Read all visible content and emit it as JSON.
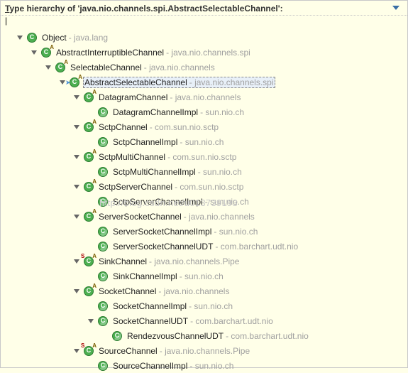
{
  "header": {
    "title_prefix": "T",
    "title_rest": "ype hierarchy of 'java.nio.channels.spi.AbstractSelectableChannel':",
    "cursor": "|"
  },
  "watermark": "http://blog.csdn.net/u013739193",
  "nodes": [
    {
      "depth": 0,
      "expand": "open",
      "icon": "class",
      "abstract": false,
      "static": false,
      "selected": false,
      "name": "Object",
      "pkg": "java.lang"
    },
    {
      "depth": 1,
      "expand": "open",
      "icon": "class",
      "abstract": true,
      "static": false,
      "selected": false,
      "name": "AbstractInterruptibleChannel",
      "pkg": "java.nio.channels.spi"
    },
    {
      "depth": 2,
      "expand": "open",
      "icon": "class",
      "abstract": true,
      "static": false,
      "selected": false,
      "name": "SelectableChannel",
      "pkg": "java.nio.channels"
    },
    {
      "depth": 3,
      "expand": "open",
      "icon": "focus",
      "abstract": true,
      "static": false,
      "selected": true,
      "name": "AbstractSelectableChannel",
      "pkg": "java.nio.channels.spi"
    },
    {
      "depth": 4,
      "expand": "open",
      "icon": "class",
      "abstract": true,
      "static": false,
      "selected": false,
      "name": "DatagramChannel",
      "pkg": "java.nio.channels"
    },
    {
      "depth": 5,
      "expand": "none",
      "icon": "impl",
      "abstract": false,
      "static": false,
      "selected": false,
      "name": "DatagramChannelImpl",
      "pkg": "sun.nio.ch"
    },
    {
      "depth": 4,
      "expand": "open",
      "icon": "class",
      "abstract": true,
      "static": false,
      "selected": false,
      "name": "SctpChannel",
      "pkg": "com.sun.nio.sctp"
    },
    {
      "depth": 5,
      "expand": "none",
      "icon": "impl",
      "abstract": false,
      "static": false,
      "selected": false,
      "name": "SctpChannelImpl",
      "pkg": "sun.nio.ch"
    },
    {
      "depth": 4,
      "expand": "open",
      "icon": "class",
      "abstract": true,
      "static": false,
      "selected": false,
      "name": "SctpMultiChannel",
      "pkg": "com.sun.nio.sctp"
    },
    {
      "depth": 5,
      "expand": "none",
      "icon": "impl",
      "abstract": false,
      "static": false,
      "selected": false,
      "name": "SctpMultiChannelImpl",
      "pkg": "sun.nio.ch"
    },
    {
      "depth": 4,
      "expand": "open",
      "icon": "class",
      "abstract": true,
      "static": false,
      "selected": false,
      "name": "SctpServerChannel",
      "pkg": "com.sun.nio.sctp"
    },
    {
      "depth": 5,
      "expand": "none",
      "icon": "impl",
      "abstract": false,
      "static": false,
      "selected": false,
      "name": "SctpServerChannelImpl",
      "pkg": "sun.nio.ch"
    },
    {
      "depth": 4,
      "expand": "open",
      "icon": "class",
      "abstract": true,
      "static": false,
      "selected": false,
      "name": "ServerSocketChannel",
      "pkg": "java.nio.channels"
    },
    {
      "depth": 5,
      "expand": "none",
      "icon": "impl",
      "abstract": false,
      "static": false,
      "selected": false,
      "name": "ServerSocketChannelImpl",
      "pkg": "sun.nio.ch"
    },
    {
      "depth": 5,
      "expand": "none",
      "icon": "impl",
      "abstract": false,
      "static": false,
      "selected": false,
      "name": "ServerSocketChannelUDT",
      "pkg": "com.barchart.udt.nio"
    },
    {
      "depth": 4,
      "expand": "open",
      "icon": "class",
      "abstract": true,
      "static": true,
      "selected": false,
      "name": "SinkChannel",
      "pkg": "java.nio.channels.Pipe"
    },
    {
      "depth": 5,
      "expand": "none",
      "icon": "impl",
      "abstract": false,
      "static": false,
      "selected": false,
      "name": "SinkChannelImpl",
      "pkg": "sun.nio.ch"
    },
    {
      "depth": 4,
      "expand": "open",
      "icon": "class",
      "abstract": true,
      "static": false,
      "selected": false,
      "name": "SocketChannel",
      "pkg": "java.nio.channels"
    },
    {
      "depth": 5,
      "expand": "none",
      "icon": "impl",
      "abstract": false,
      "static": false,
      "selected": false,
      "name": "SocketChannelImpl",
      "pkg": "sun.nio.ch"
    },
    {
      "depth": 5,
      "expand": "open",
      "icon": "impl",
      "abstract": false,
      "static": false,
      "selected": false,
      "name": "SocketChannelUDT",
      "pkg": "com.barchart.udt.nio"
    },
    {
      "depth": 6,
      "expand": "none",
      "icon": "impl",
      "abstract": false,
      "static": false,
      "selected": false,
      "name": "RendezvousChannelUDT",
      "pkg": "com.barchart.udt.nio"
    },
    {
      "depth": 4,
      "expand": "open",
      "icon": "class",
      "abstract": true,
      "static": true,
      "selected": false,
      "name": "SourceChannel",
      "pkg": "java.nio.channels.Pipe"
    },
    {
      "depth": 5,
      "expand": "none",
      "icon": "impl",
      "abstract": false,
      "static": false,
      "selected": false,
      "name": "SourceChannelImpl",
      "pkg": "sun.nio.ch"
    }
  ]
}
